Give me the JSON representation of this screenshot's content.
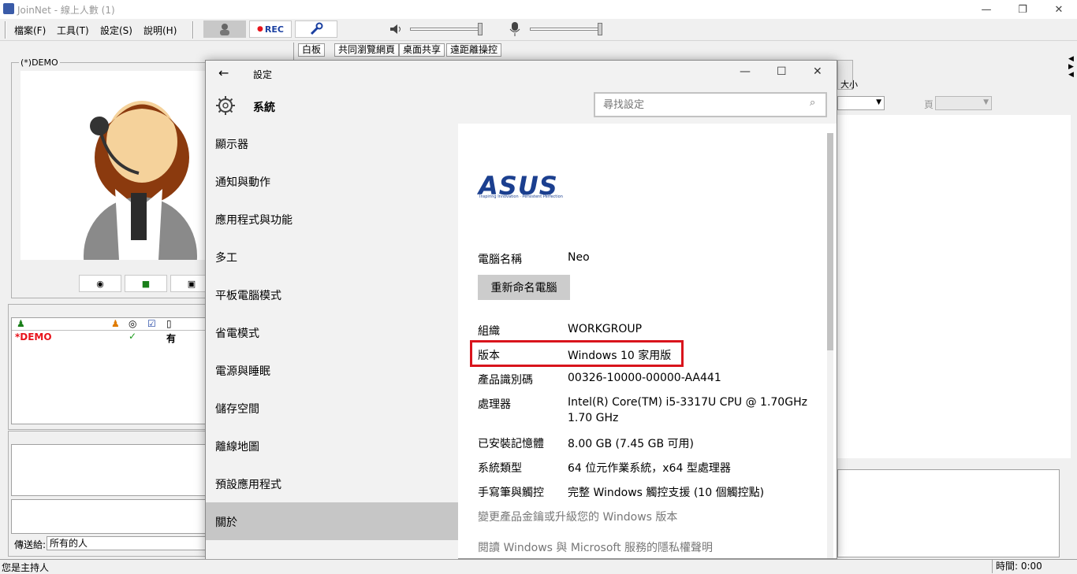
{
  "app": {
    "title": "JoinNet - 線上人數 (1)",
    "menu": [
      "檔案(F)",
      "工具(T)",
      "設定(S)",
      "說明(H)"
    ],
    "rec_label": "REC",
    "tabs": [
      "白板",
      "共同瀏覽網頁",
      "桌面共享",
      "遠距離操控"
    ],
    "video_label": "(*)DEMO",
    "wb_size_label": "大小",
    "page_label": "頁",
    "participant": {
      "name": "*DEMO",
      "check": "✓",
      "has": "有"
    },
    "send_to_label": "傳送給:",
    "send_to_value": "所有的人",
    "status_left": "您是主持人",
    "status_time": "時間: 0:00",
    "accent_red": "#e8141c"
  },
  "settings": {
    "title": "設定",
    "section": "系統",
    "search_placeholder": "尋找設定",
    "nav": [
      "顯示器",
      "通知與動作",
      "應用程式與功能",
      "多工",
      "平板電腦模式",
      "省電模式",
      "電源與睡眠",
      "儲存空間",
      "離線地圖",
      "預設應用程式",
      "關於"
    ],
    "selected": "關於",
    "brand_logo": "ASUS",
    "brand_tagline": "Inspiring Innovation · Persistent Perfection",
    "pc_name_label": "電腦名稱",
    "pc_name": "Neo",
    "rename_button": "重新命名電腦",
    "rows": [
      {
        "label": "組織",
        "value": "WORKGROUP"
      },
      {
        "label": "版本",
        "value": "Windows 10 家用版"
      },
      {
        "label": "產品識別碼",
        "value": "00326-10000-00000-AA441"
      },
      {
        "label": "處理器",
        "value": "Intel(R) Core(TM) i5-3317U CPU @ 1.70GHz",
        "value2": "1.70 GHz"
      },
      {
        "label": "已安裝記憶體",
        "value": "8.00 GB (7.45 GB 可用)"
      },
      {
        "label": "系統類型",
        "value": "64 位元作業系統，x64 型處理器"
      },
      {
        "label": "手寫筆與觸控",
        "value": "完整 Windows 觸控支援 (10 個觸控點)"
      }
    ],
    "link1": "變更產品金鑰或升級您的 Windows 版本",
    "link2": "閱讀 Windows 與 Microsoft 服務的隱私權聲明",
    "highlight_color": "#d9141c"
  }
}
